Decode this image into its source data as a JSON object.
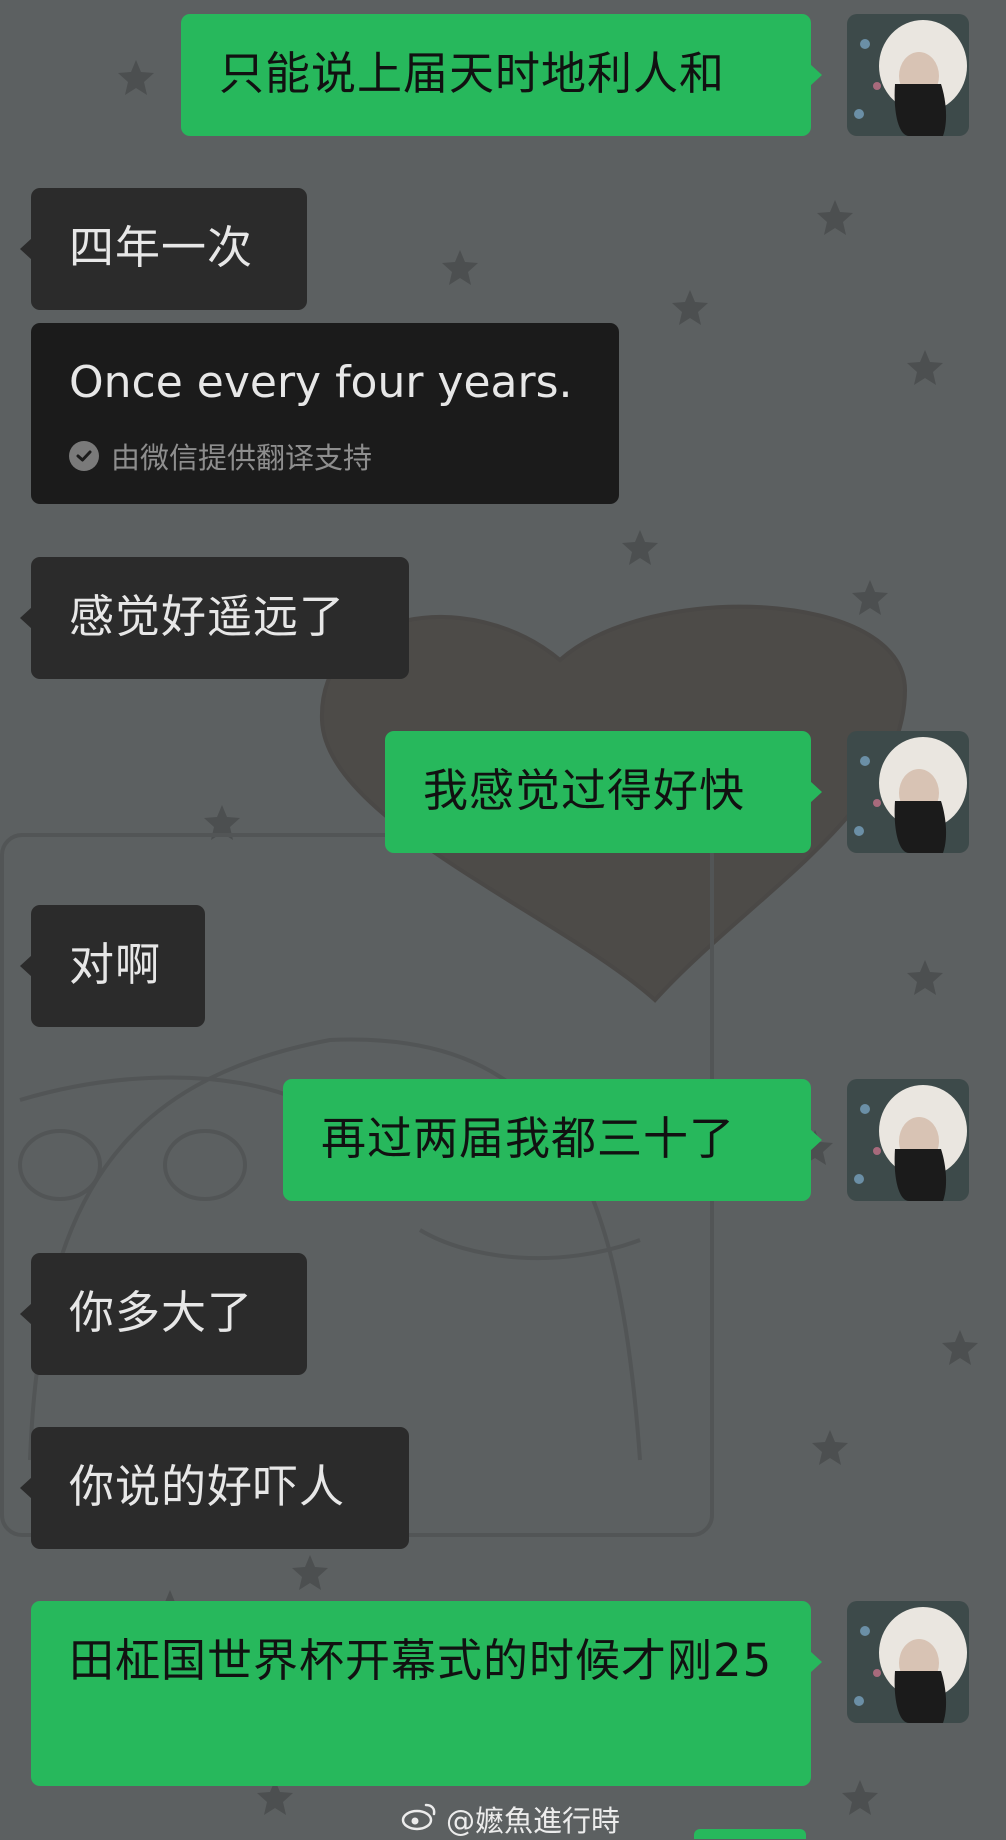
{
  "chat": {
    "messages": [
      {
        "side": "out",
        "text": "只能说上届天时地利人和"
      },
      {
        "side": "in",
        "text": "四年一次"
      },
      {
        "side": "in",
        "text": "Once every four years.",
        "translation_credit": "由微信提供翻译支持"
      },
      {
        "side": "in",
        "text": "感觉好遥远了"
      },
      {
        "side": "out",
        "text": "我感觉过得好快"
      },
      {
        "side": "in",
        "text": "对啊"
      },
      {
        "side": "out",
        "text": "再过两届我都三十了"
      },
      {
        "side": "in",
        "text": "你多大了"
      },
      {
        "side": "in",
        "text": "你说的好吓人"
      },
      {
        "side": "out",
        "text": "田柾国世界杯开幕式的时候才刚25"
      }
    ]
  },
  "avatar": {
    "icon": "user-avatar-icon"
  },
  "watermark": {
    "text": "@嬷魚進行時",
    "icon": "weibo-icon"
  },
  "colors": {
    "background": "#5c6061",
    "incoming_bubble": "#2b2b2b",
    "translation_bubble": "#1b1b1b",
    "outgoing_bubble": "#27b85c"
  }
}
